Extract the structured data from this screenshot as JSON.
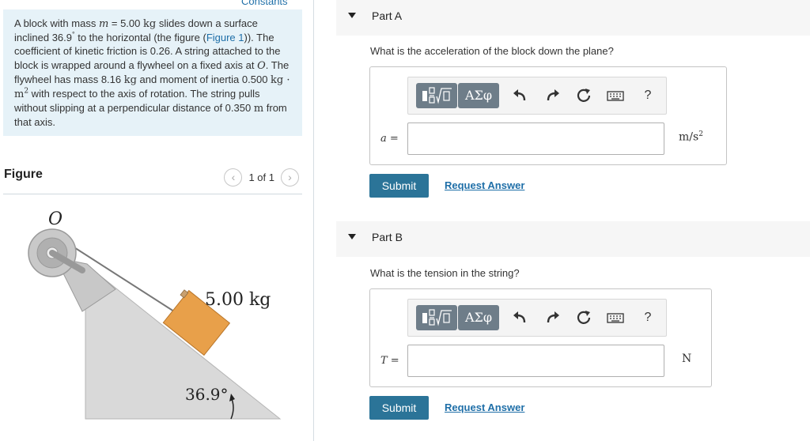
{
  "header": {
    "constants_label": "Constants"
  },
  "problem": {
    "t1": "A block with mass ",
    "m_var": "m",
    "t2": " = 5.00 ",
    "unit_kg": "kg",
    "t3": " slides down a surface inclined 36.9",
    "deg": "°",
    "t4": " to the horizontal (the figure (",
    "figure_link": "Figure 1",
    "t5": ")). The coefficient of kinetic friction is 0.26. A string attached to the block is wrapped around a flywheel on a fixed axis at ",
    "o_var": "O",
    "t6": ". The flywheel has mass 8.16 ",
    "unit_kg2": "kg",
    "t7": " and moment of inertia 0.500 ",
    "unit_inertia": "kg · m",
    "inertia_exp": "2",
    "t8": " with respect to the axis of rotation. The string pulls without slipping at a perpendicular distance of 0.350 ",
    "unit_m": "m",
    "t9": " from that axis."
  },
  "figure_panel": {
    "title": "Figure",
    "pager_text": "1 of 1",
    "prev_icon": "chevron-left-icon",
    "next_icon": "chevron-right-icon",
    "fig_label_o": "O",
    "fig_label_mass": "5.00 kg",
    "fig_label_angle": "36.9°"
  },
  "parts": [
    {
      "title": "Part A",
      "question": "What is the acceleration of the block down the plane?",
      "var": "a",
      "eq": " =",
      "value": "",
      "unit": "m/s",
      "unit_exp": "2",
      "submit": "Submit",
      "request": "Request Answer"
    },
    {
      "title": "Part B",
      "question": "What is the tension in the string?",
      "var": "T",
      "eq": " =",
      "value": "",
      "unit": "N",
      "unit_exp": "",
      "submit": "Submit",
      "request": "Request Answer"
    }
  ],
  "toolbar": {
    "greek_label": "ΑΣφ",
    "help_label": "?",
    "icons": [
      "template-icon",
      "greek-symbols-icon",
      "undo-icon",
      "redo-icon",
      "reset-icon",
      "keyboard-icon",
      "help-icon"
    ]
  },
  "colors": {
    "accent": "#2b7498",
    "link": "#1f6fa8",
    "problem_bg": "#e6f2f8",
    "block": "#e8a04a"
  }
}
